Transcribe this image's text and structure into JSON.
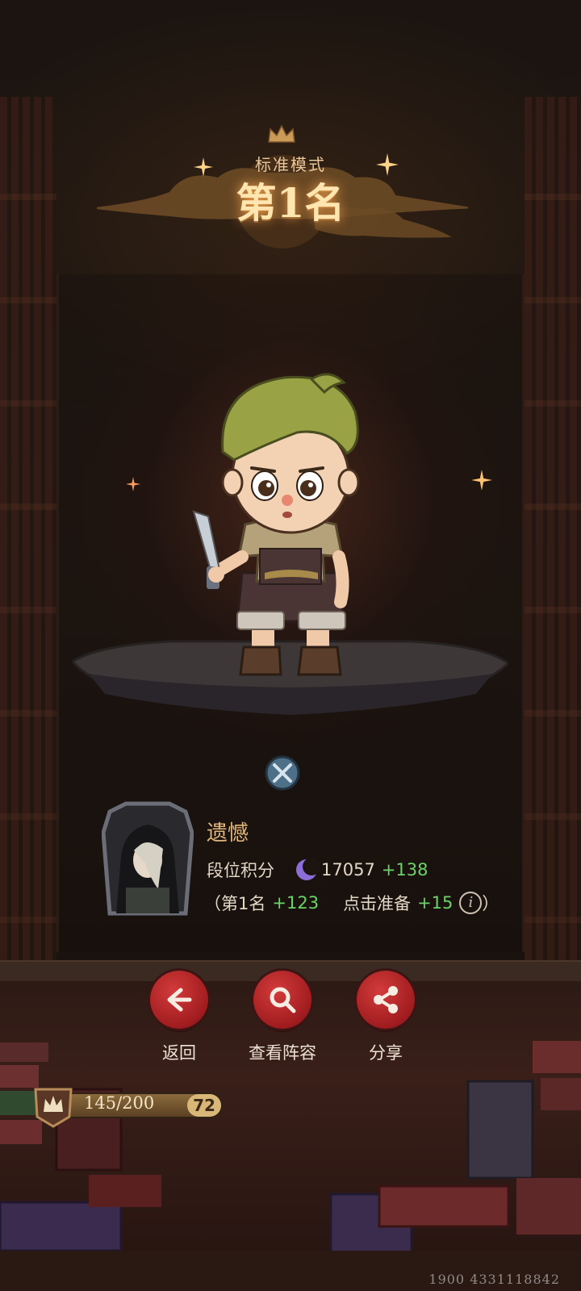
{
  "header": {
    "mode_label": "标准模式",
    "rank_title": "第1名"
  },
  "player": {
    "name": "遗憾",
    "rank_points_label": "段位积分",
    "points_value": "17057",
    "points_delta": "+138",
    "breakdown_open": "（",
    "placement_label": "第1名",
    "placement_bonus": "+123",
    "ready_label": "点击准备",
    "ready_bonus": "+15",
    "breakdown_close": "）",
    "info_icon_glyph": "i"
  },
  "actions": [
    {
      "label": "返回",
      "icon": "arrow-left-icon"
    },
    {
      "label": "查看阵容",
      "icon": "magnifier-icon"
    },
    {
      "label": "分享",
      "icon": "share-icon"
    }
  ],
  "level": {
    "progress_text": "145/200",
    "progress_fraction": 0.725,
    "level_number": "72"
  },
  "footer": {
    "id_text": "1900 4331118842"
  },
  "colors": {
    "accent_red": "#c02a2c",
    "gain_green": "#6ad466",
    "gold": "#e2b77c"
  }
}
